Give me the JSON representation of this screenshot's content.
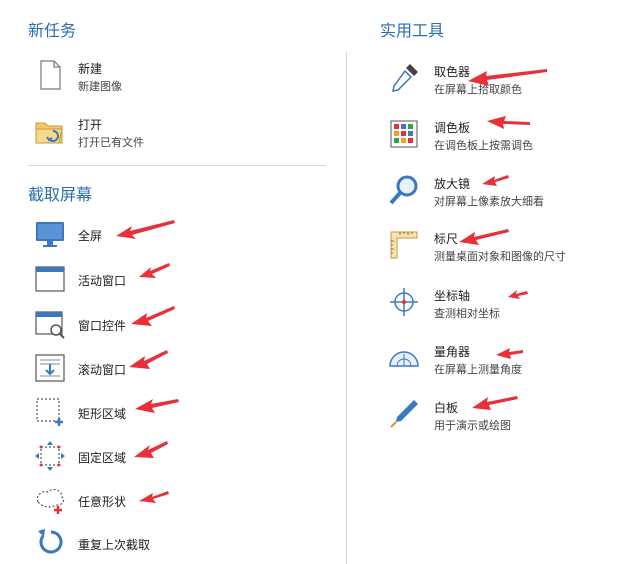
{
  "new_task": {
    "title": "新任务",
    "new": {
      "label": "新建",
      "desc": "新建图像"
    },
    "open": {
      "label": "打开",
      "desc": "打开已有文件"
    }
  },
  "capture": {
    "title": "截取屏幕",
    "items": [
      {
        "label": "全屏"
      },
      {
        "label": "活动窗口"
      },
      {
        "label": "窗口控件"
      },
      {
        "label": "滚动窗口"
      },
      {
        "label": "矩形区域"
      },
      {
        "label": "固定区域"
      },
      {
        "label": "任意形状"
      },
      {
        "label": "重复上次截取"
      }
    ]
  },
  "tools": {
    "title": "实用工具",
    "items": [
      {
        "label": "取色器",
        "desc": "在屏幕上拾取颜色"
      },
      {
        "label": "调色板",
        "desc": "在调色板上按需调色"
      },
      {
        "label": "放大镜",
        "desc": "对屏幕上像素放大细看"
      },
      {
        "label": "标尺",
        "desc": "测量桌面对象和图像的尺寸"
      },
      {
        "label": "坐标轴",
        "desc": "查测相对坐标"
      },
      {
        "label": "量角器",
        "desc": "在屏幕上测量角度"
      },
      {
        "label": "白板",
        "desc": "用于演示或绘图"
      }
    ]
  },
  "colors": {
    "accent": "#2a6db3",
    "arrow": "#e8303a",
    "icon_blue": "#3a78c2"
  }
}
